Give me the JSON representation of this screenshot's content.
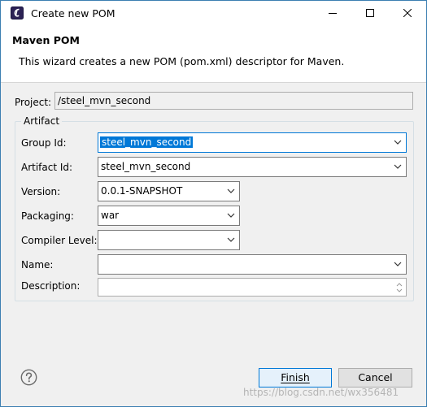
{
  "window": {
    "title": "Create new POM"
  },
  "banner": {
    "title": "Maven POM",
    "description": "This wizard creates a new POM (pom.xml) descriptor for Maven."
  },
  "project": {
    "label": "Project:",
    "value": "/steel_mvn_second"
  },
  "artifact": {
    "group_label": "Artifact",
    "group_id": {
      "label": "Group Id:",
      "value": "steel_mvn_second"
    },
    "artifact_id": {
      "label": "Artifact Id:",
      "value": "steel_mvn_second"
    },
    "version": {
      "label": "Version:",
      "value": "0.0.1-SNAPSHOT"
    },
    "packaging": {
      "label": "Packaging:",
      "value": "war"
    },
    "compiler_level": {
      "label": "Compiler Level:",
      "value": ""
    },
    "name": {
      "label": "Name:",
      "value": ""
    },
    "description": {
      "label": "Description:",
      "value": ""
    }
  },
  "footer": {
    "finish_label": "Finish",
    "cancel_label": "Cancel"
  },
  "watermark": "https://blog.csdn.net/wx356481",
  "colors": {
    "accent": "#0078d7",
    "window_border": "#3c7fb1",
    "dialog_bg": "#f0f0f0"
  },
  "icons": [
    "eclipse-app-icon",
    "minimize-icon",
    "maximize-icon",
    "close-icon",
    "chevron-down-icon",
    "help-icon",
    "spinner-arrows-icon"
  ]
}
